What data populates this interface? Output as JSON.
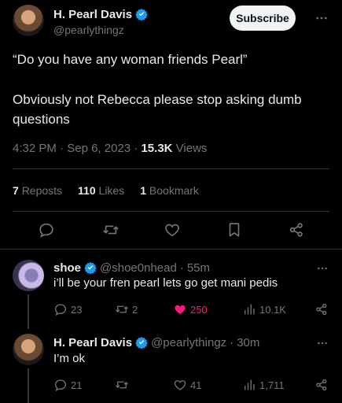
{
  "main_tweet": {
    "author_name": "H. Pearl Davis",
    "handle": "@pearlythingz",
    "subscribe_label": "Subscribe",
    "text_line1": "“Do you have any woman friends Pearl”",
    "text_line2": "Obviously not Rebecca please stop asking dumb",
    "text_line3": "questions",
    "time": "4:32 PM",
    "date": "Sep 6, 2023",
    "views_count": "15.3K",
    "views_label": "Views",
    "reposts_count": "7",
    "reposts_label": "Reposts",
    "likes_count": "110",
    "likes_label": "Likes",
    "bookmarks_count": "1",
    "bookmarks_label": "Bookmark"
  },
  "replies": [
    {
      "author_name": "shoe",
      "handle": "@shoe0nhead",
      "time_ago": "55m",
      "text": "i’ll be your fren pearl lets go get mani pedis",
      "replies": "23",
      "reposts": "2",
      "likes": "250",
      "views": "10.1K"
    },
    {
      "author_name": "H. Pearl Davis",
      "handle": "@pearlythingz",
      "time_ago": "30m",
      "text": "I’m ok",
      "replies": "21",
      "reposts": "",
      "likes": "41",
      "views": "1,711"
    }
  ],
  "colors": {
    "background": "#000000",
    "text": "#e7e9ea",
    "muted": "#71767b",
    "verified": "#1d9bf0",
    "liked": "#f91880",
    "divider": "#2f3336"
  }
}
